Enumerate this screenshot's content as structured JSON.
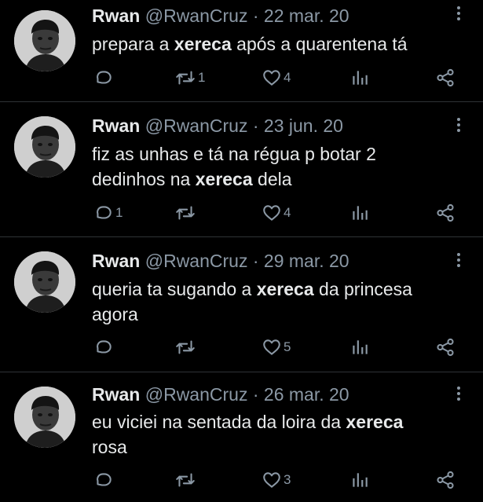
{
  "tweets": [
    {
      "name": "Rwan",
      "handle": "@RwanCruz",
      "separator": "·",
      "date": "22 mar. 20",
      "text_lines": [
        [
          {
            "t": "prepara a "
          },
          {
            "t": "xereca",
            "b": true
          },
          {
            "t": " após a quarentena tá"
          }
        ]
      ],
      "reply_count": "",
      "retweet_count": "1",
      "like_count": "4"
    },
    {
      "name": "Rwan",
      "handle": "@RwanCruz",
      "separator": "·",
      "date": "23 jun. 20",
      "text_lines": [
        [
          {
            "t": "fiz as unhas e tá na régua p botar 2"
          }
        ],
        [
          {
            "t": "dedinhos na "
          },
          {
            "t": "xereca",
            "b": true
          },
          {
            "t": " dela"
          }
        ]
      ],
      "reply_count": "1",
      "retweet_count": "",
      "like_count": "4"
    },
    {
      "name": "Rwan",
      "handle": "@RwanCruz",
      "separator": "·",
      "date": "29 mar. 20",
      "text_lines": [
        [
          {
            "t": "queria ta sugando a "
          },
          {
            "t": "xereca",
            "b": true
          },
          {
            "t": " da princesa"
          }
        ],
        [
          {
            "t": "agora"
          }
        ]
      ],
      "reply_count": "",
      "retweet_count": "",
      "like_count": "5"
    },
    {
      "name": "Rwan",
      "handle": "@RwanCruz",
      "separator": "·",
      "date": "26 mar. 20",
      "text_lines": [
        [
          {
            "t": "eu viciei na sentada da loira da "
          },
          {
            "t": "xereca",
            "b": true
          }
        ],
        [
          {
            "t": "rosa"
          }
        ]
      ],
      "reply_count": "",
      "retweet_count": "",
      "like_count": "3"
    }
  ],
  "icons": {
    "reply": "reply-icon",
    "retweet": "retweet-icon",
    "like": "like-icon",
    "views": "views-icon",
    "share": "share-icon",
    "more": "more-icon"
  },
  "colors": {
    "background": "#000000",
    "text": "#e7e9ea",
    "muted": "#8b98a5",
    "divider": "#2f3336"
  }
}
